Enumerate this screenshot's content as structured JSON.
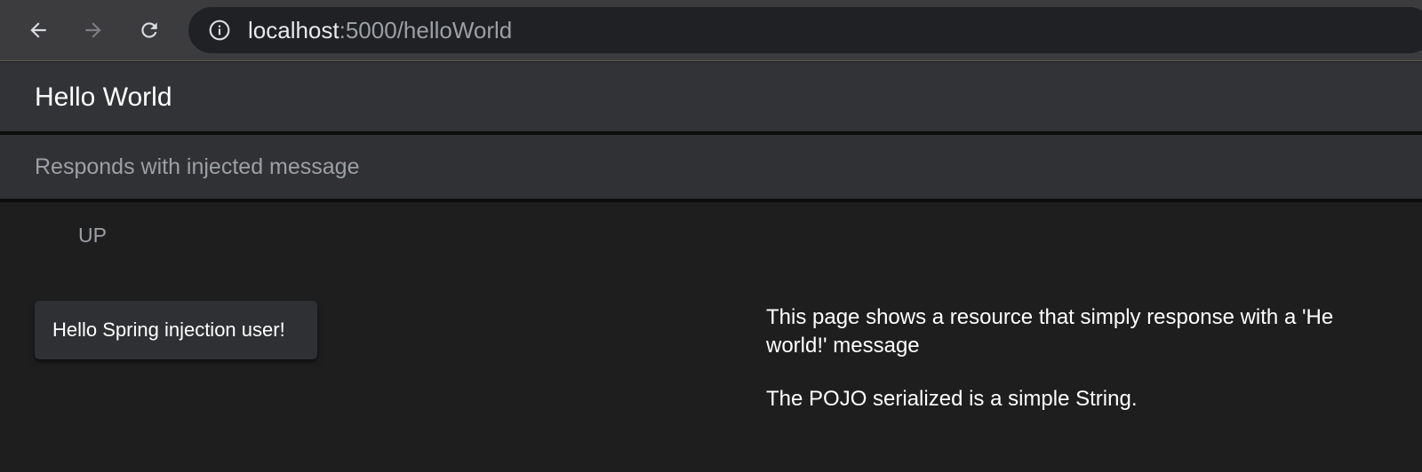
{
  "browser": {
    "url_host": "localhost",
    "url_rest": ":5000/helloWorld"
  },
  "header": {
    "title": "Hello World"
  },
  "subheader": {
    "description": "Responds with injected message"
  },
  "main": {
    "status": "UP",
    "message_card": "Hello Spring injection user!",
    "info_line1": "This page shows a resource that simply response with a 'He",
    "info_line2": "world!' message",
    "info_line3": "The POJO serialized is a simple String."
  },
  "icons": {
    "back": "arrow-left-icon",
    "forward": "arrow-right-icon",
    "reload": "reload-icon",
    "site_info": "info-icon"
  },
  "colors": {
    "page_bg": "#1e1e1f",
    "header_bg": "#323336",
    "card_bg": "#2f3033",
    "muted_text": "#9aa0a6"
  }
}
